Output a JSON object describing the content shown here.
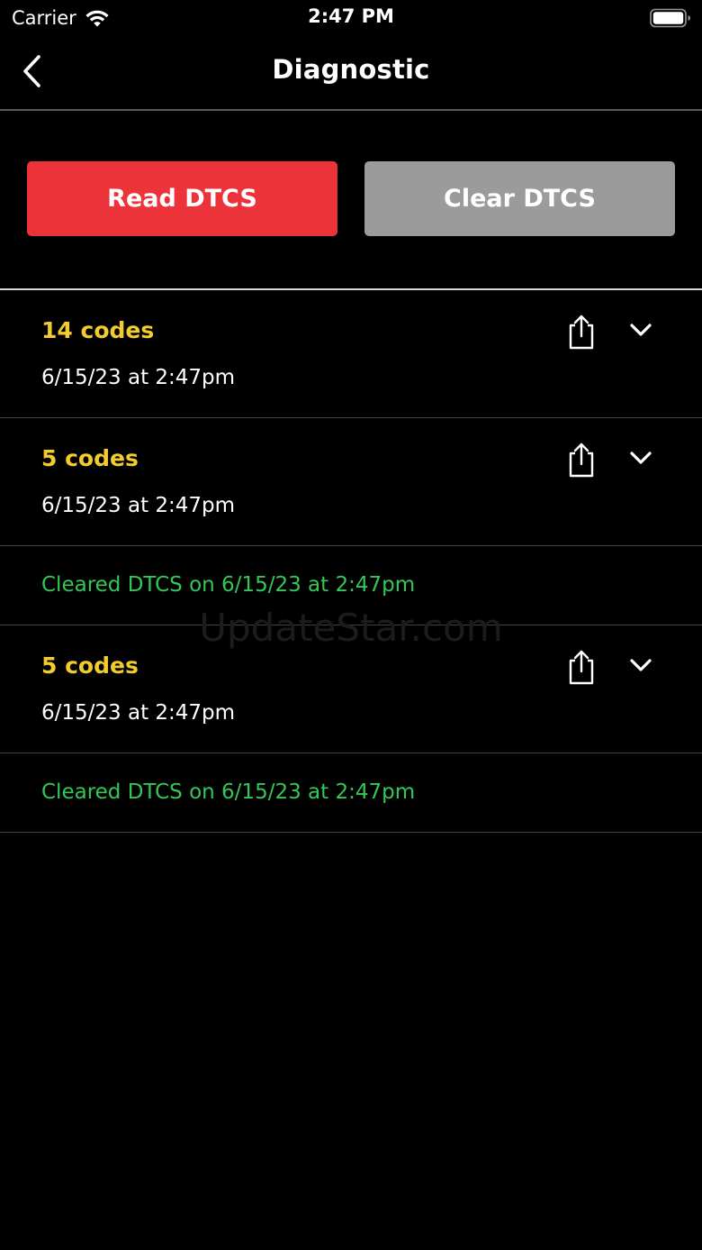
{
  "status_bar": {
    "carrier": "Carrier",
    "time": "2:47 PM",
    "icons": [
      "wifi-icon",
      "battery-icon"
    ]
  },
  "nav": {
    "title": "Diagnostic",
    "back_icon": "chevron-left-icon"
  },
  "actions": {
    "read_label": "Read DTCS",
    "clear_label": "Clear DTCS"
  },
  "records": [
    {
      "type": "scan",
      "count": "14 codes",
      "timestamp": "6/15/23 at 2:47pm"
    },
    {
      "type": "scan",
      "count": "5 codes",
      "timestamp": "6/15/23 at 2:47pm"
    },
    {
      "type": "cleared",
      "text": "Cleared DTCS on 6/15/23 at 2:47pm"
    },
    {
      "type": "scan",
      "count": "5 codes",
      "timestamp": "6/15/23 at 2:47pm"
    },
    {
      "type": "cleared",
      "text": "Cleared DTCS on 6/15/23 at 2:47pm"
    }
  ],
  "watermark": "UpdateStar.com",
  "colors": {
    "background": "#000000",
    "read_button": "#ec3339",
    "clear_button": "#9b9b9b",
    "code_count": "#f2cc2c",
    "cleared_text": "#34c758"
  }
}
